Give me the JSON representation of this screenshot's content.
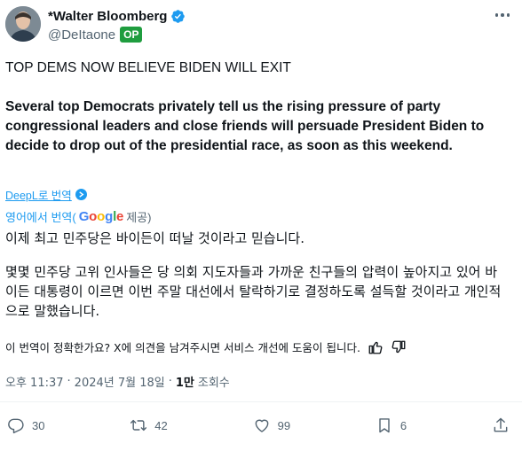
{
  "author": {
    "display_name": "*Walter Bloomberg",
    "handle": "@DeItaone",
    "badge": "OP",
    "verified": true
  },
  "tweet": {
    "headline": "TOP DEMS NOW BELIEVE BIDEN WILL EXIT",
    "body": "Several top Democrats privately tell us the rising pressure of party congressional leaders and close friends will persuade President Biden to decide to drop out of the presidential race, as soon as this weekend."
  },
  "translation": {
    "deepl_label": "DeepL로 번역",
    "translated_from": "영어에서 번역(",
    "google_letters": [
      "G",
      "o",
      "o",
      "g",
      "l",
      "e"
    ],
    "provided": "제공)",
    "paragraph1": "이제 최고 민주당은 바이든이 떠날 것이라고 믿습니다.",
    "paragraph2": "몇몇 민주당 고위 인사들은 당 의회 지도자들과 가까운 친구들의 압력이 높아지고 있어 바이든 대통령이 이르면 이번 주말 대선에서 탈락하기로 결정하도록 설득할 것이라고 개인적으로 말했습니다.",
    "feedback_question": "이 번역이 정확한가요? X에 의견을 남겨주시면 서비스 개선에 도움이 됩니다."
  },
  "meta": {
    "time": "오후 11:37",
    "date": "2024년 7월 18일",
    "separator": "·",
    "views_count": "1만",
    "views_label": "조회수"
  },
  "actions": {
    "replies": "30",
    "retweets": "42",
    "likes": "99",
    "bookmarks": "6"
  },
  "colors": {
    "accent": "#1d9bf0",
    "op_badge": "#1f9d3f",
    "muted_text": "#536471",
    "primary_text": "#0f1419"
  }
}
